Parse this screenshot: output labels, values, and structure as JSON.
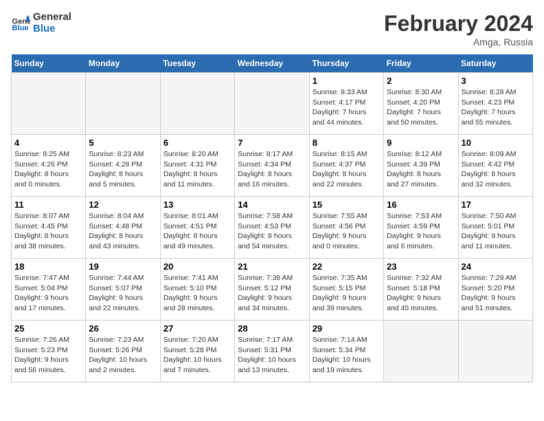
{
  "header": {
    "logo_line1": "General",
    "logo_line2": "Blue",
    "month_year": "February 2024",
    "location": "Amga, Russia"
  },
  "weekdays": [
    "Sunday",
    "Monday",
    "Tuesday",
    "Wednesday",
    "Thursday",
    "Friday",
    "Saturday"
  ],
  "weeks": [
    [
      {
        "day": "",
        "info": ""
      },
      {
        "day": "",
        "info": ""
      },
      {
        "day": "",
        "info": ""
      },
      {
        "day": "",
        "info": ""
      },
      {
        "day": "1",
        "info": "Sunrise: 8:33 AM\nSunset: 4:17 PM\nDaylight: 7 hours\nand 44 minutes."
      },
      {
        "day": "2",
        "info": "Sunrise: 8:30 AM\nSunset: 4:20 PM\nDaylight: 7 hours\nand 50 minutes."
      },
      {
        "day": "3",
        "info": "Sunrise: 8:28 AM\nSunset: 4:23 PM\nDaylight: 7 hours\nand 55 minutes."
      }
    ],
    [
      {
        "day": "4",
        "info": "Sunrise: 8:25 AM\nSunset: 4:26 PM\nDaylight: 8 hours\nand 0 minutes."
      },
      {
        "day": "5",
        "info": "Sunrise: 8:23 AM\nSunset: 4:28 PM\nDaylight: 8 hours\nand 5 minutes."
      },
      {
        "day": "6",
        "info": "Sunrise: 8:20 AM\nSunset: 4:31 PM\nDaylight: 8 hours\nand 11 minutes."
      },
      {
        "day": "7",
        "info": "Sunrise: 8:17 AM\nSunset: 4:34 PM\nDaylight: 8 hours\nand 16 minutes."
      },
      {
        "day": "8",
        "info": "Sunrise: 8:15 AM\nSunset: 4:37 PM\nDaylight: 8 hours\nand 22 minutes."
      },
      {
        "day": "9",
        "info": "Sunrise: 8:12 AM\nSunset: 4:39 PM\nDaylight: 8 hours\nand 27 minutes."
      },
      {
        "day": "10",
        "info": "Sunrise: 8:09 AM\nSunset: 4:42 PM\nDaylight: 8 hours\nand 32 minutes."
      }
    ],
    [
      {
        "day": "11",
        "info": "Sunrise: 8:07 AM\nSunset: 4:45 PM\nDaylight: 8 hours\nand 38 minutes."
      },
      {
        "day": "12",
        "info": "Sunrise: 8:04 AM\nSunset: 4:48 PM\nDaylight: 8 hours\nand 43 minutes."
      },
      {
        "day": "13",
        "info": "Sunrise: 8:01 AM\nSunset: 4:51 PM\nDaylight: 8 hours\nand 49 minutes."
      },
      {
        "day": "14",
        "info": "Sunrise: 7:58 AM\nSunset: 4:53 PM\nDaylight: 8 hours\nand 54 minutes."
      },
      {
        "day": "15",
        "info": "Sunrise: 7:55 AM\nSunset: 4:56 PM\nDaylight: 9 hours\nand 0 minutes."
      },
      {
        "day": "16",
        "info": "Sunrise: 7:53 AM\nSunset: 4:59 PM\nDaylight: 9 hours\nand 6 minutes."
      },
      {
        "day": "17",
        "info": "Sunrise: 7:50 AM\nSunset: 5:01 PM\nDaylight: 9 hours\nand 11 minutes."
      }
    ],
    [
      {
        "day": "18",
        "info": "Sunrise: 7:47 AM\nSunset: 5:04 PM\nDaylight: 9 hours\nand 17 minutes."
      },
      {
        "day": "19",
        "info": "Sunrise: 7:44 AM\nSunset: 5:07 PM\nDaylight: 9 hours\nand 22 minutes."
      },
      {
        "day": "20",
        "info": "Sunrise: 7:41 AM\nSunset: 5:10 PM\nDaylight: 9 hours\nand 28 minutes."
      },
      {
        "day": "21",
        "info": "Sunrise: 7:38 AM\nSunset: 5:12 PM\nDaylight: 9 hours\nand 34 minutes."
      },
      {
        "day": "22",
        "info": "Sunrise: 7:35 AM\nSunset: 5:15 PM\nDaylight: 9 hours\nand 39 minutes."
      },
      {
        "day": "23",
        "info": "Sunrise: 7:32 AM\nSunset: 5:18 PM\nDaylight: 9 hours\nand 45 minutes."
      },
      {
        "day": "24",
        "info": "Sunrise: 7:29 AM\nSunset: 5:20 PM\nDaylight: 9 hours\nand 51 minutes."
      }
    ],
    [
      {
        "day": "25",
        "info": "Sunrise: 7:26 AM\nSunset: 5:23 PM\nDaylight: 9 hours\nand 56 minutes."
      },
      {
        "day": "26",
        "info": "Sunrise: 7:23 AM\nSunset: 5:26 PM\nDaylight: 10 hours\nand 2 minutes."
      },
      {
        "day": "27",
        "info": "Sunrise: 7:20 AM\nSunset: 5:28 PM\nDaylight: 10 hours\nand 7 minutes."
      },
      {
        "day": "28",
        "info": "Sunrise: 7:17 AM\nSunset: 5:31 PM\nDaylight: 10 hours\nand 13 minutes."
      },
      {
        "day": "29",
        "info": "Sunrise: 7:14 AM\nSunset: 5:34 PM\nDaylight: 10 hours\nand 19 minutes."
      },
      {
        "day": "",
        "info": ""
      },
      {
        "day": "",
        "info": ""
      }
    ]
  ]
}
